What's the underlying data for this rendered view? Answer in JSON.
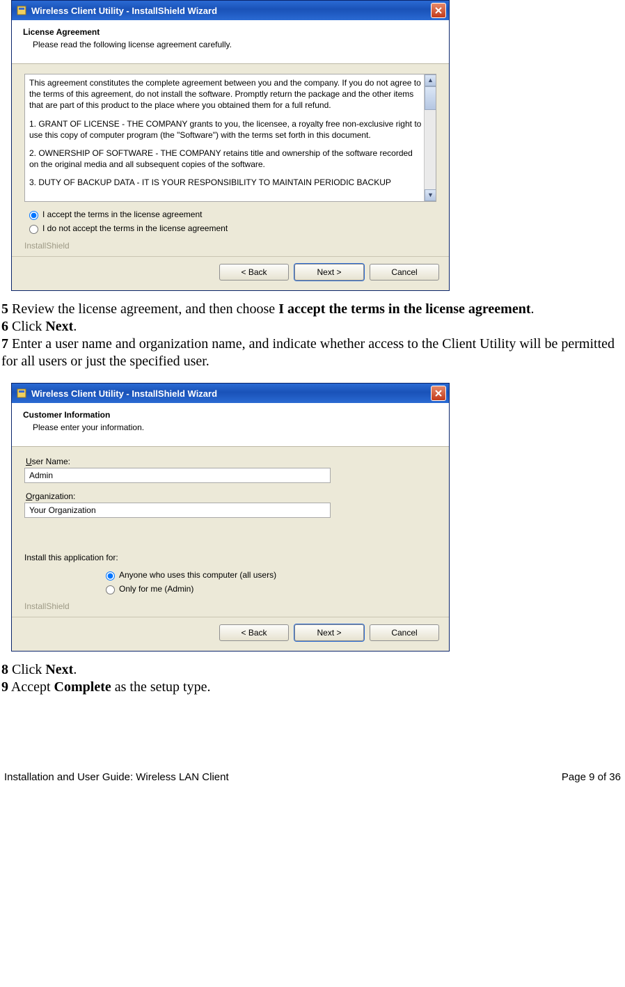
{
  "dialog1": {
    "title": "Wireless Client Utility - InstallShield Wizard",
    "header_title": "License Agreement",
    "header_sub": "Please read the following license agreement carefully.",
    "license_p1": "This agreement constitutes the complete agreement between you and the company. If you do not agree to the terms of this agreement, do not install the software. Promptly return the package and the other items that are part of this product to the place where you obtained them for a full refund.",
    "license_p2": "1.   GRANT OF LICENSE - THE COMPANY grants to you, the licensee, a royalty free non-exclusive right to use this copy of computer program (the \"Software\") with the terms set forth in this document.",
    "license_p3": "2.   OWNERSHIP OF SOFTWARE - THE COMPANY retains title and ownership of the software recorded on the original media and all subsequent copies of the software.",
    "license_p4": "3.   DUTY OF BACKUP DATA - IT IS YOUR RESPONSIBILITY TO MAINTAIN PERIODIC BACKUP",
    "radio_accept": "I accept the terms in the license agreement",
    "radio_reject": "I do not accept the terms in the license agreement",
    "brand": "InstallShield",
    "btn_back": "< Back",
    "btn_next": "Next >",
    "btn_cancel": "Cancel"
  },
  "instr1": {
    "s5n": "5",
    "s5t": " Review the license agreement, and then choose ",
    "s5b": "I accept the terms in the license agreement",
    "s5e": ".",
    "s6n": "6",
    "s6t": " Click ",
    "s6b": "Next",
    "s6e": ".",
    "s7n": "7",
    "s7t": " Enter a user name and organization name, and indicate whether access to the Client Utility will be permitted for all users or just the specified user."
  },
  "dialog2": {
    "title": "Wireless Client Utility - InstallShield Wizard",
    "header_title": "Customer Information",
    "header_sub": "Please enter your information.",
    "user_label": "User Name:",
    "user_value": "Admin",
    "org_label": "Organization:",
    "org_value": "Your Organization",
    "install_for": "Install this application for:",
    "radio_all": "Anyone who uses this computer (all users)",
    "radio_me": "Only for me (Admin)",
    "brand": "InstallShield",
    "btn_back": "< Back",
    "btn_next": "Next >",
    "btn_cancel": "Cancel"
  },
  "instr2": {
    "s8n": "8",
    "s8t": " Click ",
    "s8b": "Next",
    "s8e": ".",
    "s9n": "9",
    "s9t": " Accept ",
    "s9b": "Complete",
    "s9e": " as the setup type."
  },
  "footer": {
    "left": "Installation and User Guide: Wireless LAN Client",
    "right": "Page 9 of 36"
  }
}
